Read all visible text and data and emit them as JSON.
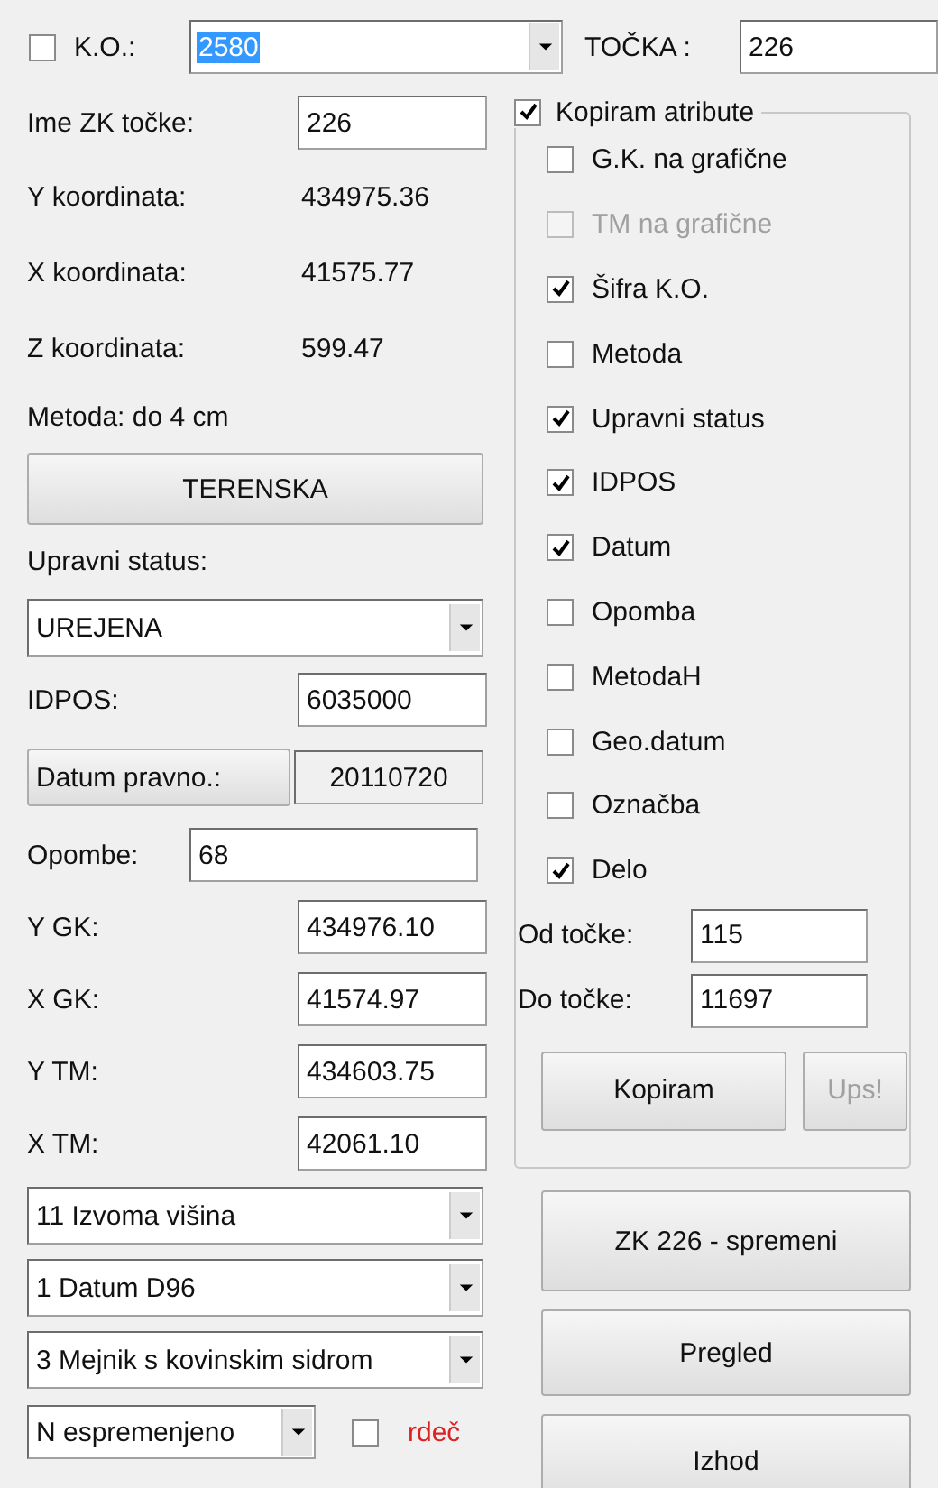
{
  "top": {
    "ko_label": "K.O.:",
    "ko_checked": false,
    "ko_value": "2580",
    "tocka_label": "TOČKA :",
    "tocka_value": "226"
  },
  "left": [
    {
      "kind": "field",
      "label": "Ime ZK točke:",
      "value": "226"
    },
    {
      "kind": "reading",
      "label": "Y koordinata:",
      "value": "434975.36"
    },
    {
      "kind": "reading",
      "label": "X koordinata:",
      "value": "41575.77"
    },
    {
      "kind": "reading",
      "label": "Z koordinata:",
      "value": "599.47"
    },
    {
      "kind": "note",
      "label": "Metoda: do 4 cm"
    },
    {
      "kind": "button",
      "label": "TERENSKA"
    },
    {
      "kind": "note",
      "label": "Upravni status:"
    },
    {
      "kind": "combo",
      "value": "UREJENA"
    },
    {
      "kind": "field",
      "label": "IDPOS:",
      "value": "6035000"
    },
    {
      "kind": "button_field",
      "label": "Datum pravno.:",
      "value": "20110720"
    },
    {
      "kind": "wide_field",
      "label": "Opombe:",
      "value": "68"
    },
    {
      "kind": "field",
      "label": "Y GK:",
      "value": "434976.10"
    },
    {
      "kind": "field",
      "label": "X GK:",
      "value": "41574.97"
    },
    {
      "kind": "field",
      "label": "Y TM:",
      "value": "434603.75"
    },
    {
      "kind": "field",
      "label": "X TM:",
      "value": "42061.10"
    },
    {
      "kind": "combo",
      "value": "11 Izvoma višina"
    },
    {
      "kind": "combo",
      "value": "1 Datum D96"
    },
    {
      "kind": "combo",
      "value": "3 Mejnik s kovinskim sidrom"
    }
  ],
  "bottom": {
    "combo_value": "N espremenjeno",
    "check_label": "rdeč",
    "checked": false
  },
  "copy_group": {
    "label": "Kopiram atribute",
    "checked": true,
    "options": [
      {
        "label": "G.K. na grafične",
        "checked": false,
        "disabled": false
      },
      {
        "label": "TM na grafične",
        "checked": false,
        "disabled": true
      },
      {
        "label": "Šifra K.O.",
        "checked": true,
        "disabled": false
      },
      {
        "label": "Metoda",
        "checked": false,
        "disabled": false
      },
      {
        "label": "Upravni status",
        "checked": true,
        "disabled": false
      },
      {
        "label": "IDPOS",
        "checked": true,
        "disabled": false
      },
      {
        "label": "Datum",
        "checked": true,
        "disabled": false
      },
      {
        "label": "Opomba",
        "checked": false,
        "disabled": false
      },
      {
        "label": "MetodaH",
        "checked": false,
        "disabled": false
      },
      {
        "label": "Geo.datum",
        "checked": false,
        "disabled": false
      },
      {
        "label": "Označba",
        "checked": false,
        "disabled": false
      },
      {
        "label": "Delo",
        "checked": true,
        "disabled": false
      }
    ],
    "range": [
      {
        "label": "Od točke:",
        "value": "115"
      },
      {
        "label": "Do točke:",
        "value": "11697"
      }
    ],
    "buttons": [
      {
        "label": "Kopiram",
        "disabled": false
      },
      {
        "label": "Ups!",
        "disabled": true
      }
    ]
  },
  "actions": [
    "ZK 226 - spremeni",
    "Pregled",
    "Izhod"
  ]
}
